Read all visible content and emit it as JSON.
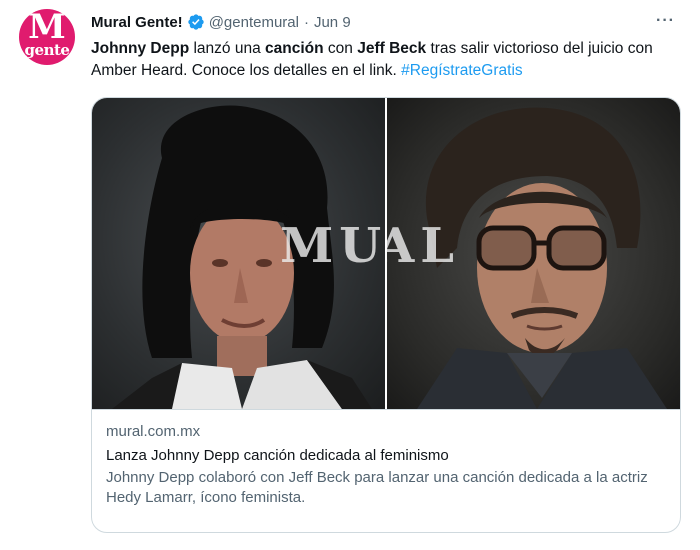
{
  "avatar": {
    "line1": "M",
    "line2": "gente"
  },
  "header": {
    "name": "Mural Gente!",
    "handle": "@gentemural",
    "separator": "·",
    "date": "Jun 9",
    "more": "···"
  },
  "tweet": {
    "bold1": "Johnny Depp",
    "text1": " lanzó una ",
    "bold2": "canción",
    "text2": " con ",
    "bold3": "Jeff Beck",
    "text3": " tras salir victorioso del juicio con Amber Heard. Conoce los detalles en el link.  ",
    "hashtag": "#RegístrateGratis"
  },
  "card": {
    "watermark": "MURAL",
    "domain": "mural.com.mx",
    "title": "Lanza Johnny Depp canción dedicada al feminismo",
    "description": "Johnny Depp colaboró con Jeff Beck para lanzar una canción dedicada a la actriz Hedy Lamarr, ícono feminista."
  },
  "colors": {
    "brand": "#e01b6e",
    "link": "#1d9bf0",
    "secondary_text": "#536471",
    "border": "#cfd9de"
  }
}
